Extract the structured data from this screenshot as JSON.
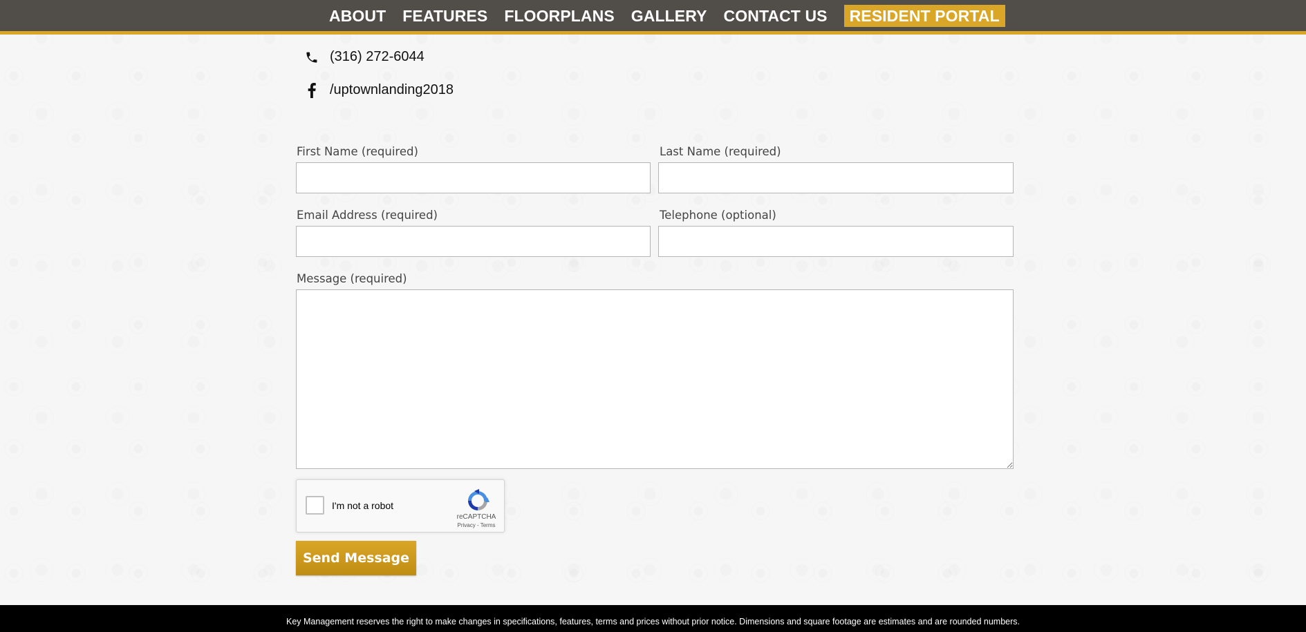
{
  "nav": {
    "items": [
      {
        "label": "ABOUT"
      },
      {
        "label": "FEATURES"
      },
      {
        "label": "FLOORPLANS"
      },
      {
        "label": "GALLERY"
      },
      {
        "label": "CONTACT US"
      },
      {
        "label": "RESIDENT PORTAL"
      }
    ],
    "accent_color": "#d9a627",
    "bar_color": "#514d48"
  },
  "contact": {
    "phone": "(316) 272-6044",
    "phone_icon": "phone-icon",
    "facebook": "/uptownlanding2018",
    "facebook_icon": "facebook-icon"
  },
  "form": {
    "first_name_label": "First Name (required)",
    "first_name_value": "",
    "last_name_label": "Last Name (required)",
    "last_name_value": "",
    "email_label": "Email Address (required)",
    "email_value": "",
    "telephone_label": "Telephone (optional)",
    "telephone_value": "",
    "message_label": "Message (required)",
    "message_value": "",
    "captcha_label": "I'm not a robot",
    "captcha_brand": "reCAPTCHA",
    "captcha_links": "Privacy - Terms",
    "captcha_checked": false,
    "submit_label": "Send Message"
  },
  "footer": {
    "text": "Key Management reserves the right to make changes in specifications, features, terms and prices without prior notice. Dimensions and square footage are estimates and are rounded numbers."
  }
}
